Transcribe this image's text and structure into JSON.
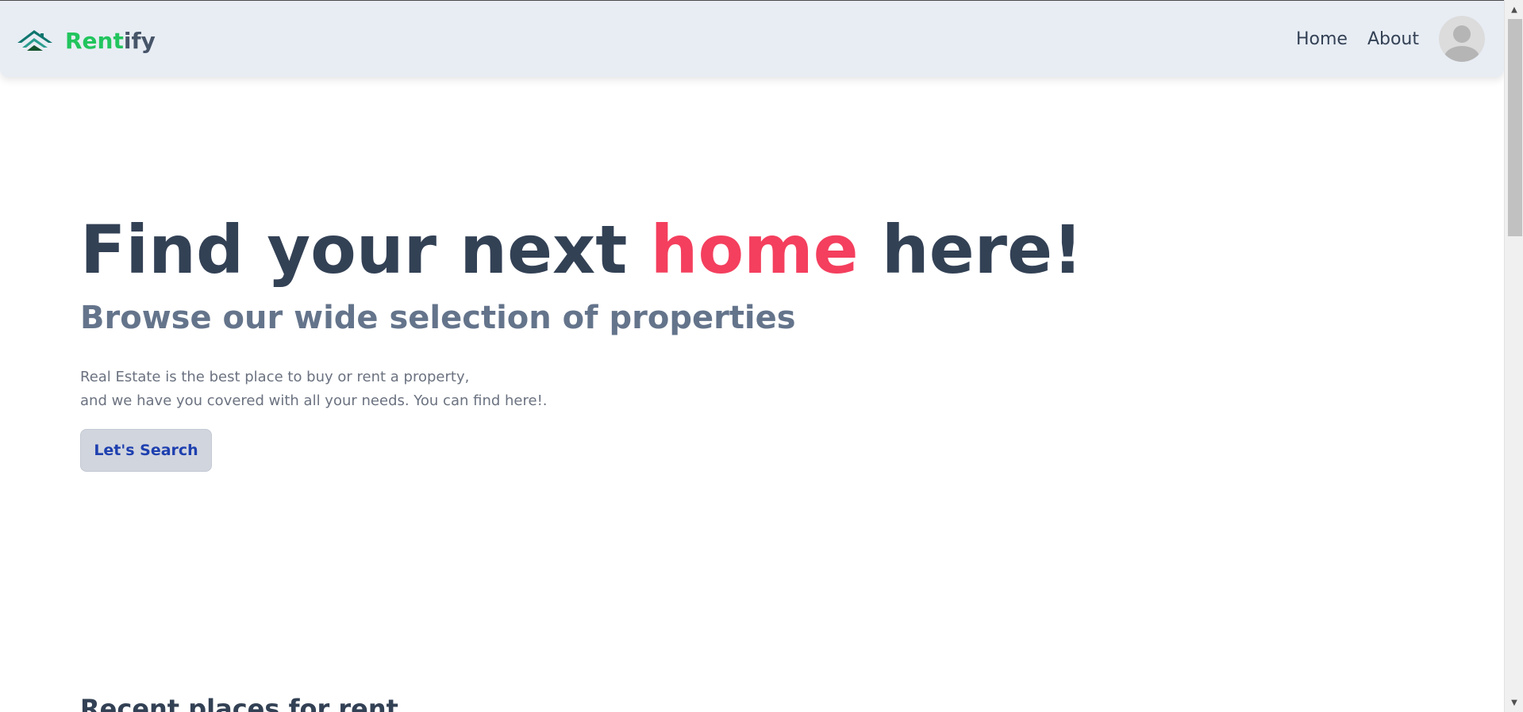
{
  "navbar": {
    "brand": {
      "name_part1": "Rent",
      "name_part2": "ify"
    },
    "links": [
      {
        "label": "Home"
      },
      {
        "label": "About"
      }
    ]
  },
  "hero": {
    "title_before": "Find your next",
    "title_highlight": "home",
    "title_after": "here!",
    "subtitle": "Browse our wide selection of properties",
    "description_line1": "Real Estate is the best place to buy or rent a property,",
    "description_line2": "and we have you covered with all your needs. You can find here!.",
    "cta_label": "Let's Search"
  },
  "recent": {
    "heading": "Recent places for rent"
  },
  "colors": {
    "nav_bg": "#e8edf4",
    "brand_green": "#22c55e",
    "brand_slate": "#475569",
    "title": "#334155",
    "highlight": "#f43f5e",
    "button_text": "#1e40af"
  },
  "icons": {
    "logo": "house-roof-logo-icon",
    "avatar": "user-avatar-icon"
  }
}
